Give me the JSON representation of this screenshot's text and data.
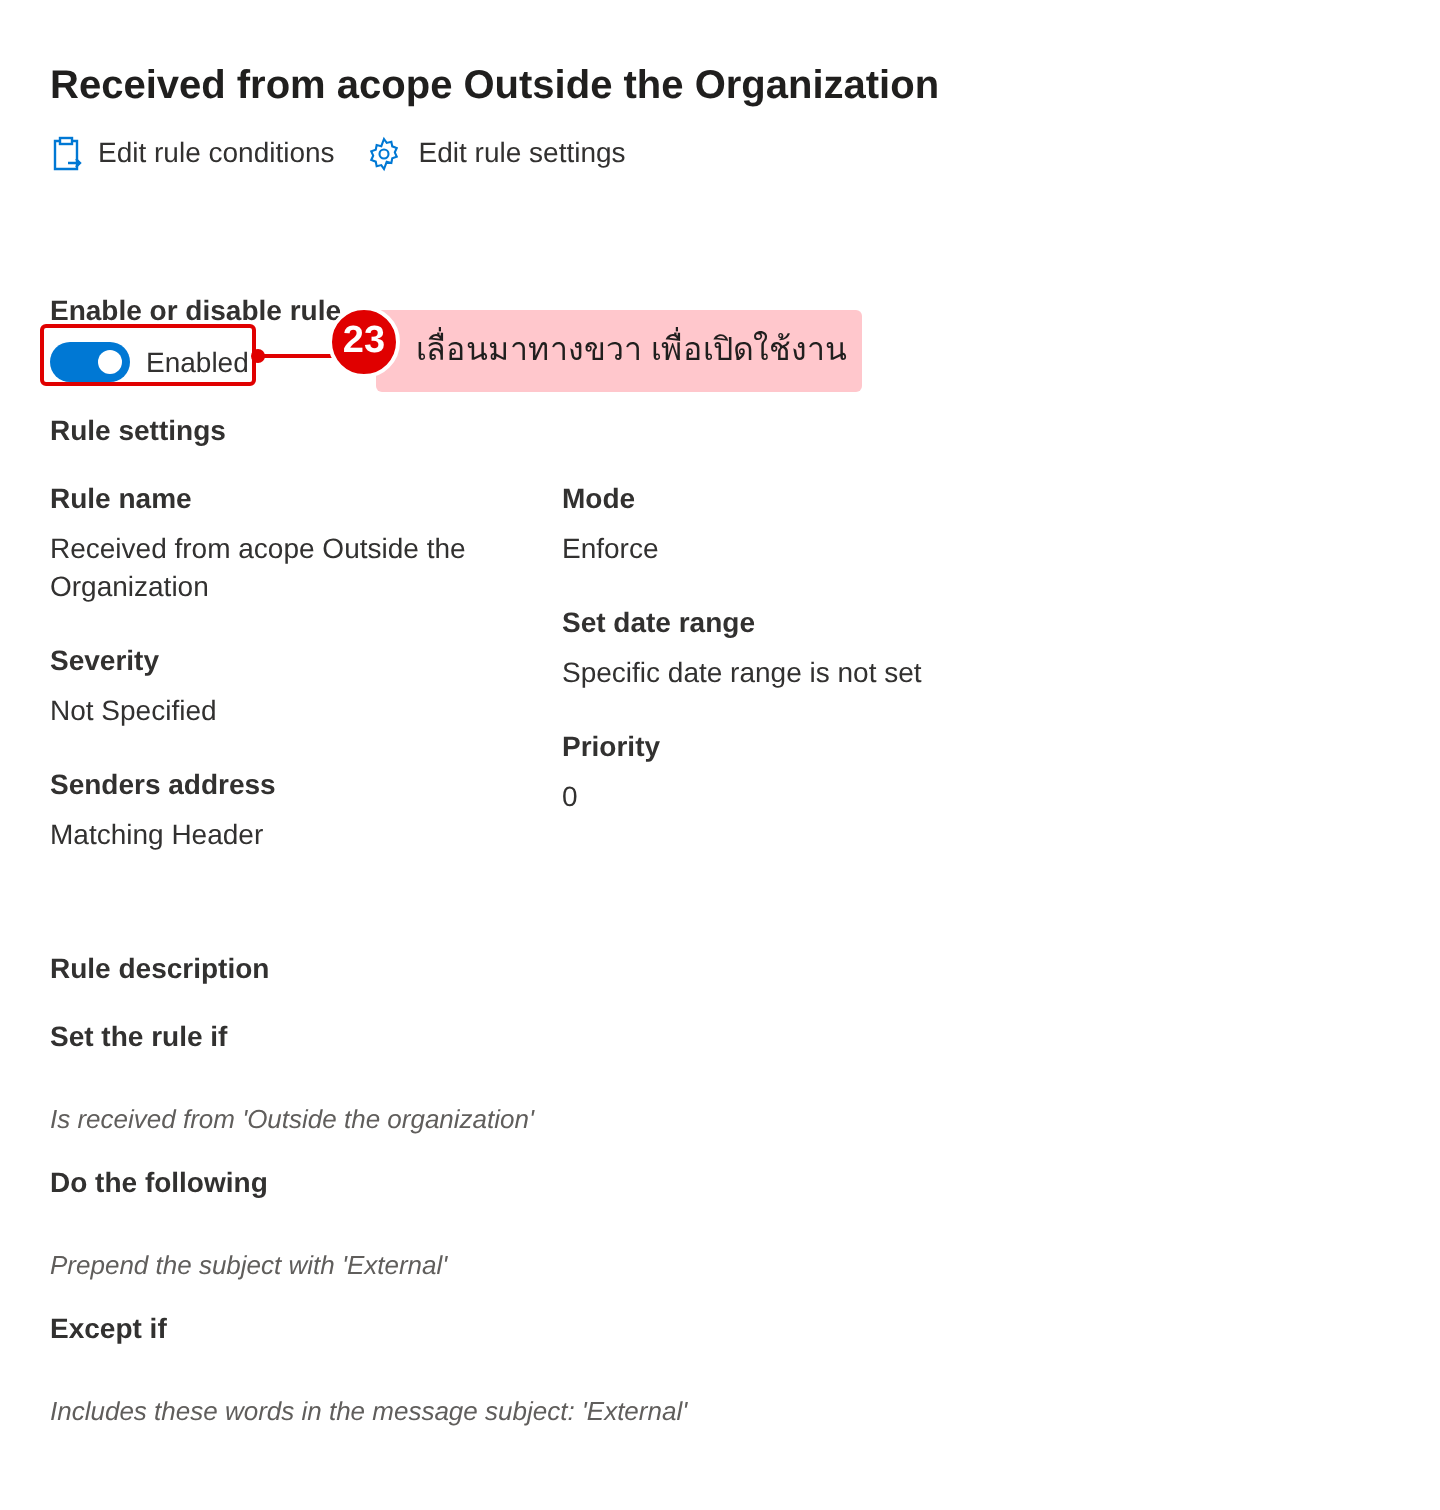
{
  "title": "Received from acope Outside the Organization",
  "actions": [
    {
      "label": "Edit rule conditions",
      "kind": "conditions"
    },
    {
      "label": "Edit rule settings",
      "kind": "settings"
    }
  ],
  "toggle": {
    "label": "Enable or disable rule",
    "on": true,
    "state_text": "Enabled"
  },
  "annotation": {
    "number": "23",
    "text": "เลื่อนมาทางขวา เพื่อเปิดใช้งาน"
  },
  "rule_settings": {
    "heading": "Rule settings",
    "left": [
      {
        "label": "Rule name",
        "value": "Received from acope Outside the Organization"
      },
      {
        "label": "Severity",
        "value": "Not Specified"
      },
      {
        "label": "Senders address",
        "value": "Matching Header"
      }
    ],
    "right": [
      {
        "label": "Mode",
        "value": "Enforce"
      },
      {
        "label": "Set date range",
        "value": "Specific date range is not set"
      },
      {
        "label": "Priority",
        "value": "0"
      }
    ]
  },
  "rule_description": {
    "heading": "Rule description",
    "sections": [
      {
        "label": "Set the rule if",
        "value": "Is received from 'Outside the organization'"
      },
      {
        "label": "Do the following",
        "value": "Prepend the subject with 'External'"
      },
      {
        "label": "Except if",
        "value": "Includes these words in the message subject: 'External'"
      }
    ]
  }
}
